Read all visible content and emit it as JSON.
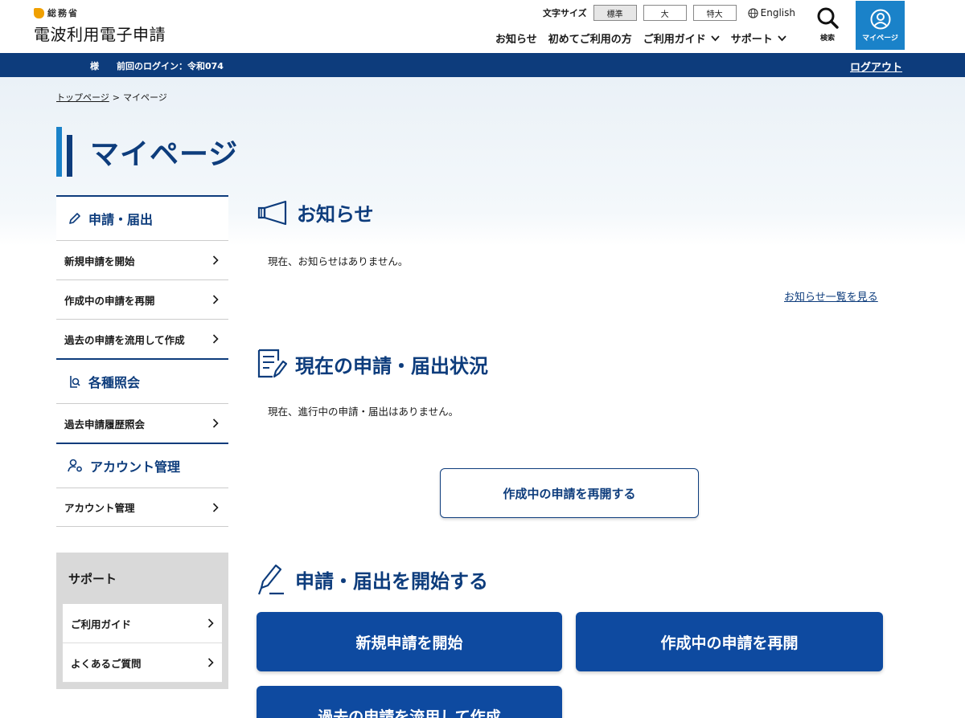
{
  "header": {
    "ministry": "総務省",
    "site_title": "電波利用電子申請",
    "fontsize_label": "文字サイズ",
    "fontsize_options": [
      "標準",
      "大",
      "特大"
    ],
    "language": "English",
    "nav": [
      "お知らせ",
      "初めてご利用の方",
      "ご利用ガイド",
      "サポート"
    ],
    "search_label": "検索",
    "mypage_label": "マイページ"
  },
  "userbar": {
    "name_suffix": "様",
    "last_login": "前回のログイン：令和074",
    "logout": "ログアウト"
  },
  "breadcrumb": {
    "top": "トップページ",
    "separator": ">",
    "current": "マイページ"
  },
  "page_title": "マイページ",
  "sidebar": {
    "section1": {
      "title": "申請・届出",
      "items": [
        "新規申請を開始",
        "作成中の申請を再開",
        "過去の申請を流用して作成"
      ]
    },
    "section2": {
      "title": "各種照会",
      "items": [
        "過去申請履歴照会"
      ]
    },
    "section3": {
      "title": "アカウント管理",
      "items": [
        "アカウント管理"
      ]
    },
    "support": {
      "title": "サポート",
      "items": [
        "ご利用ガイド",
        "よくあるご質問"
      ]
    }
  },
  "main": {
    "news": {
      "title": "お知らせ",
      "empty": "現在、お知らせはありません。",
      "link": "お知らせ一覧を見る"
    },
    "status": {
      "title": "現在の申請・届出状況",
      "empty": "現在、進行中の申請・届出はありません。",
      "resume_button": "作成中の申請を再開する"
    },
    "start": {
      "title": "申請・届出を開始する",
      "buttons": [
        "新規申請を開始",
        "作成中の申請を再開",
        "過去の申請を流用して作成"
      ]
    }
  },
  "colors": {
    "primary": "#0d3c7c",
    "accent": "#1a82c9",
    "button": "#0e4aa0",
    "logo": "#f0a000"
  }
}
